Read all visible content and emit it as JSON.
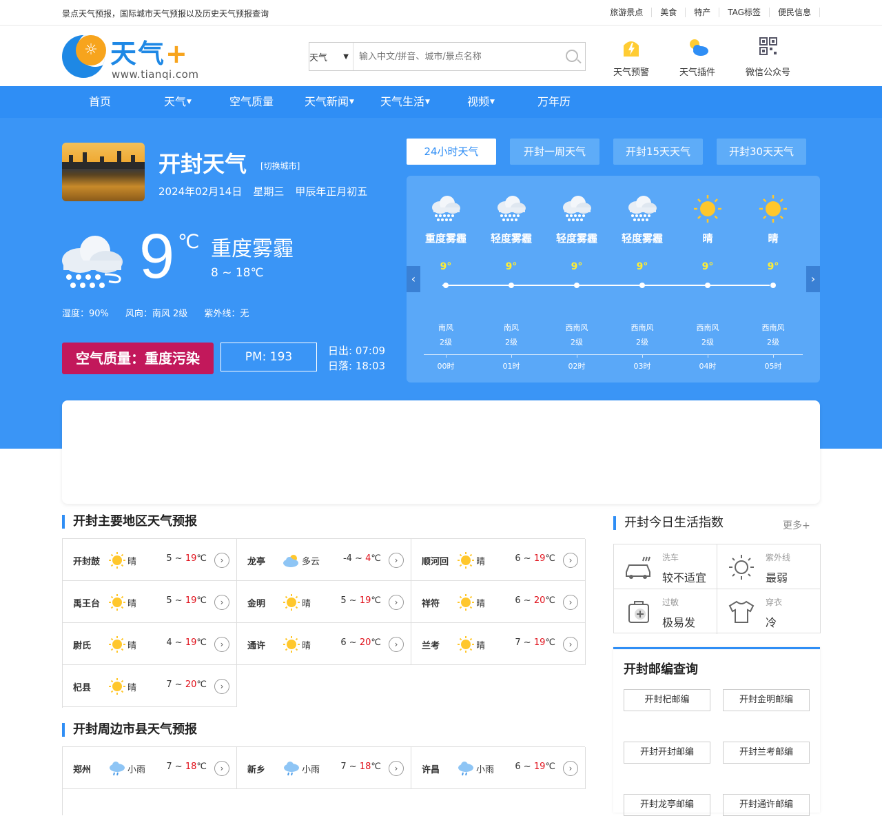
{
  "topbar": {
    "tagline": "景点天气预报，国际城市天气预报以及历史天气预报查询",
    "links": [
      "旅游景点",
      "美食",
      "特产",
      "TAG标签",
      "便民信息"
    ]
  },
  "logo": {
    "name": "天气",
    "plus": "+",
    "url": "www.tianqi.com"
  },
  "search": {
    "select_value": "天气",
    "placeholder": "输入中文/拼音、城市/景点名称"
  },
  "header_icons": [
    {
      "label": "天气预警",
      "icon": "warning-icon"
    },
    {
      "label": "天气插件",
      "icon": "plugin-icon"
    },
    {
      "label": "微信公众号",
      "icon": "qrcode-icon"
    }
  ],
  "nav": [
    "首页",
    "天气",
    "空气质量",
    "天气新闻",
    "天气生活",
    "视频",
    "万年历"
  ],
  "current": {
    "city_title": "开封天气",
    "switch_label": "[切换城市]",
    "date": "2024年02月14日",
    "weekday": "星期三",
    "lunar": "甲辰年正月初五",
    "temp": "9",
    "unit": "℃",
    "condition": "重度雾霾",
    "range": "8 ~ 18℃",
    "humidity": "湿度：90%",
    "wind": "风向：南风 2级",
    "uv": "紫外线：无",
    "aqi": "空气质量：重度污染",
    "pm": "PM: 193",
    "sunrise": "日出: 07:09",
    "sunset": "日落: 18:03"
  },
  "tabs": [
    "24小时天气",
    "开封一周天气",
    "开封15天天气",
    "开封30天天气"
  ],
  "hourly": [
    {
      "cond": "重度雾霾",
      "temp": "9°",
      "wind": "南风",
      "level": "2级",
      "time": "00时",
      "icon": "haze"
    },
    {
      "cond": "轻度雾霾",
      "temp": "9°",
      "wind": "南风",
      "level": "2级",
      "time": "01时",
      "icon": "haze"
    },
    {
      "cond": "轻度雾霾",
      "temp": "9°",
      "wind": "西南风",
      "level": "2级",
      "time": "02时",
      "icon": "haze"
    },
    {
      "cond": "轻度雾霾",
      "temp": "9°",
      "wind": "西南风",
      "level": "2级",
      "time": "03时",
      "icon": "haze"
    },
    {
      "cond": "晴",
      "temp": "9°",
      "wind": "西南风",
      "level": "2级",
      "time": "04时",
      "icon": "sun"
    },
    {
      "cond": "晴",
      "temp": "9°",
      "wind": "西南风",
      "level": "2级",
      "time": "05时",
      "icon": "sun"
    }
  ],
  "arrows": {
    "left": "‹",
    "right": "›"
  },
  "main_region": {
    "title": "开封主要地区天气预报",
    "items": [
      {
        "name": "开封鼓",
        "cond": "晴",
        "lo": "5 ~ ",
        "hi": "19",
        "unit": "℃",
        "icon": "sun"
      },
      {
        "name": "龙亭",
        "cond": "多云",
        "lo": "-4 ~ ",
        "hi": "4",
        "unit": "℃",
        "icon": "cloud"
      },
      {
        "name": "顺河回",
        "cond": "晴",
        "lo": "6 ~ ",
        "hi": "19",
        "unit": "℃",
        "icon": "sun"
      },
      {
        "name": "禹王台",
        "cond": "晴",
        "lo": "5 ~ ",
        "hi": "19",
        "unit": "℃",
        "icon": "sun"
      },
      {
        "name": "金明",
        "cond": "晴",
        "lo": "5 ~ ",
        "hi": "19",
        "unit": "℃",
        "icon": "sun"
      },
      {
        "name": "祥符",
        "cond": "晴",
        "lo": "6 ~ ",
        "hi": "20",
        "unit": "℃",
        "icon": "sun"
      },
      {
        "name": "尉氏",
        "cond": "晴",
        "lo": "4 ~ ",
        "hi": "19",
        "unit": "℃",
        "icon": "sun"
      },
      {
        "name": "通许",
        "cond": "晴",
        "lo": "6 ~ ",
        "hi": "20",
        "unit": "℃",
        "icon": "sun"
      },
      {
        "name": "兰考",
        "cond": "晴",
        "lo": "7 ~ ",
        "hi": "19",
        "unit": "℃",
        "icon": "sun"
      },
      {
        "name": "杞县",
        "cond": "晴",
        "lo": "7 ~ ",
        "hi": "20",
        "unit": "℃",
        "icon": "sun"
      }
    ]
  },
  "nearby": {
    "title": "开封周边市县天气预报",
    "items": [
      {
        "name": "郑州",
        "cond": "小雨",
        "lo": "7 ~ ",
        "hi": "18",
        "unit": "℃",
        "icon": "rain"
      },
      {
        "name": "新乡",
        "cond": "小雨",
        "lo": "7 ~ ",
        "hi": "18",
        "unit": "℃",
        "icon": "rain"
      },
      {
        "name": "许昌",
        "cond": "小雨",
        "lo": "6 ~ ",
        "hi": "19",
        "unit": "℃",
        "icon": "rain"
      }
    ]
  },
  "go_label": "›",
  "life": {
    "title": "开封今日生活指数",
    "more": "更多+",
    "items": [
      {
        "key": "洗车",
        "value": "较不适宜",
        "icon": "car-icon"
      },
      {
        "key": "紫外线",
        "value": "最弱",
        "icon": "sun-outline-icon"
      },
      {
        "key": "过敏",
        "value": "极易发",
        "icon": "allergy-icon"
      },
      {
        "key": "穿衣",
        "value": "冷",
        "icon": "shirt-icon"
      }
    ]
  },
  "zip": {
    "title": "开封邮编查询",
    "items": [
      "开封杞邮编",
      "开封金明邮编",
      "开封开封邮编",
      "开封兰考邮编",
      "开封龙亭邮编",
      "开封通许邮编"
    ]
  }
}
